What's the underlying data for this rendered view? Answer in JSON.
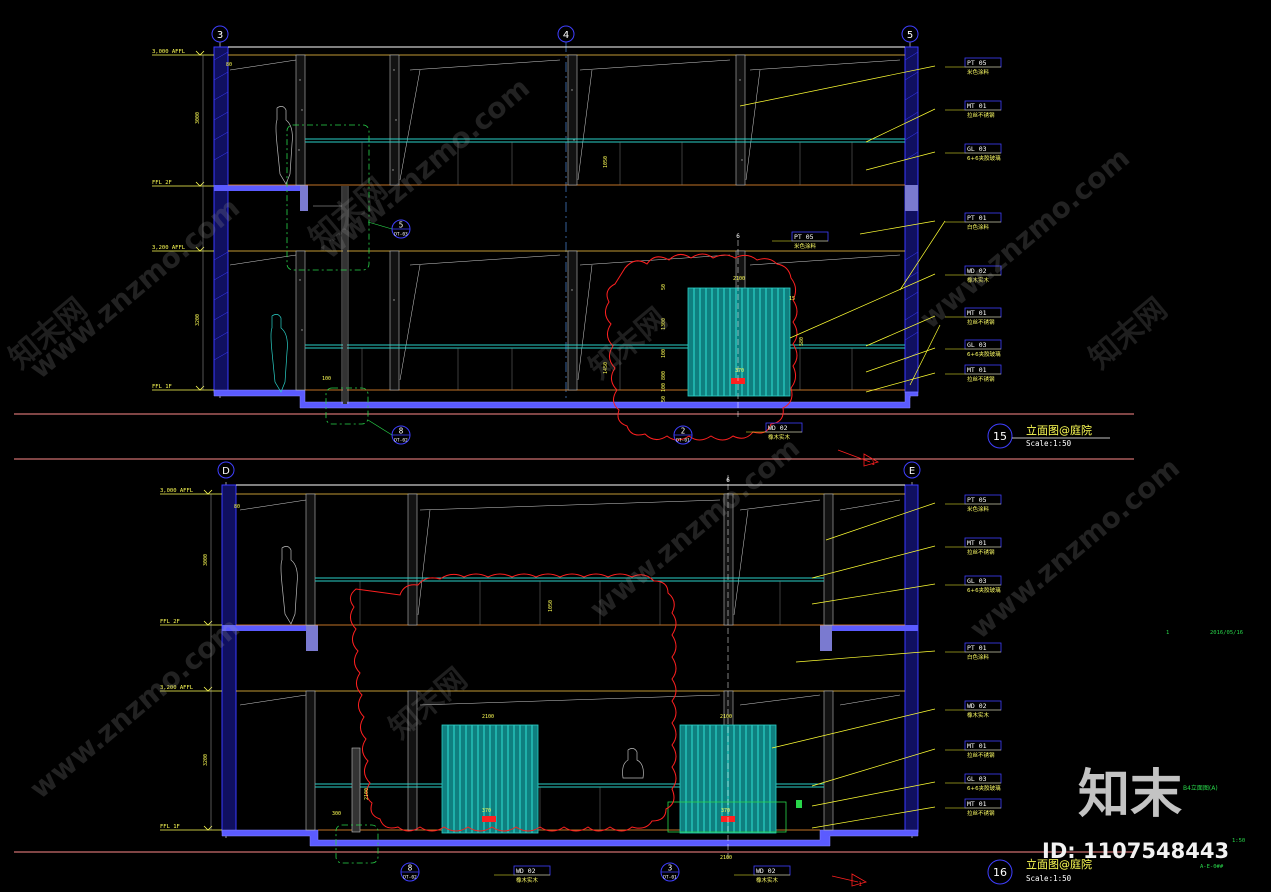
{
  "colors": {
    "background": "#000000",
    "wall": "#1f1fbf",
    "slab": "#6a6aff",
    "glass": "#2ad1c8",
    "leader": "#ffff33",
    "tag": "#3f3fff",
    "cloud": "#ff2020",
    "grid": "#ffffff",
    "door": "#18c9c9",
    "watermark": "#9a9a9a",
    "brand": "#e6e6e6",
    "level": "#ffff55",
    "green": "#28d64a"
  },
  "elevation_top": {
    "grid_bubbles": [
      "3",
      "4",
      "5"
    ],
    "levels": [
      {
        "name": "3,000 AFFL"
      },
      {
        "name": "FFL 2F"
      },
      {
        "name": "3,200 AFFL"
      },
      {
        "name": "FFL 1F"
      }
    ],
    "dims_vertical": [
      "3000",
      "3200",
      "1050",
      "1450"
    ],
    "dims_right_stack": [
      "50",
      "1300",
      "100",
      "800",
      "100",
      "50"
    ],
    "dims_small": [
      "80",
      "370",
      "100",
      "2100",
      "15",
      "580"
    ],
    "tags": [
      {
        "code": "PT 05",
        "desc": "米色涂料"
      },
      {
        "code": "MT 01",
        "desc": "拉丝不锈钢"
      },
      {
        "code": "GL 03",
        "desc": "6+6夹胶玻璃"
      },
      {
        "code": "PT 01",
        "desc": "白色涂料"
      },
      {
        "code": "WD 02",
        "desc": "橡木实木"
      },
      {
        "code": "MT 01",
        "desc": "拉丝不锈钢"
      },
      {
        "code": "GL 03",
        "desc": "6+6夹胶玻璃"
      },
      {
        "code": "MT 01",
        "desc": "拉丝不锈钢"
      }
    ],
    "mid_tag": {
      "code": "PT 05",
      "desc": "米色涂料"
    },
    "bottom_tag": {
      "code": "WD 02",
      "desc": "橡木实木"
    },
    "detail_refs": [
      {
        "num": "5",
        "sheet": "DT-03"
      },
      {
        "num": "8",
        "sheet": "DT-02"
      },
      {
        "num": "2",
        "sheet": "DT-01"
      }
    ],
    "section_mark": "6",
    "rev_mark": "1",
    "title_num": "15",
    "title": "立面图@庭院",
    "scale": "Scale:1:50"
  },
  "elevation_bottom": {
    "grid_bubbles": [
      "D",
      "E"
    ],
    "levels": [
      {
        "name": "3,000 AFFL"
      },
      {
        "name": "FFL 2F"
      },
      {
        "name": "3,200 AFFL"
      },
      {
        "name": "FFL 1F"
      }
    ],
    "dims_vertical": [
      "3000",
      "3200",
      "1050",
      "2100"
    ],
    "dims_small": [
      "80",
      "2100",
      "2100",
      "370",
      "370",
      "300",
      "2100"
    ],
    "tags": [
      {
        "code": "PT 05",
        "desc": "米色涂料"
      },
      {
        "code": "MT 01",
        "desc": "拉丝不锈钢"
      },
      {
        "code": "GL 03",
        "desc": "6+6夹胶玻璃"
      },
      {
        "code": "PT 01",
        "desc": "白色涂料"
      },
      {
        "code": "WD 02",
        "desc": "橡木实木"
      },
      {
        "code": "MT 01",
        "desc": "拉丝不锈钢"
      },
      {
        "code": "GL 03",
        "desc": "6+6夹胶玻璃"
      },
      {
        "code": "MT 01",
        "desc": "拉丝不锈钢"
      }
    ],
    "bottom_tags": [
      {
        "code": "WD 02",
        "desc": "橡木实木"
      },
      {
        "code": "WD 02",
        "desc": "橡木实木"
      }
    ],
    "detail_refs": [
      {
        "num": "8",
        "sheet": "DT-02"
      },
      {
        "num": "3",
        "sheet": "DT-01"
      }
    ],
    "section_mark": "6",
    "rev_mark": "1",
    "title_num": "16",
    "title": "立面图@庭院",
    "scale": "Scale:1:50"
  },
  "side_notes": {
    "rev_count": "1",
    "date": "2016/05/16",
    "green_label": "B4立面图(A)",
    "green_small": "A-E-0##",
    "small_num": "1:50"
  },
  "watermark": {
    "site": "www.znzmo.com",
    "cn": "知末网"
  },
  "brand": {
    "logo": "知末",
    "id": "ID: 1107548443"
  }
}
